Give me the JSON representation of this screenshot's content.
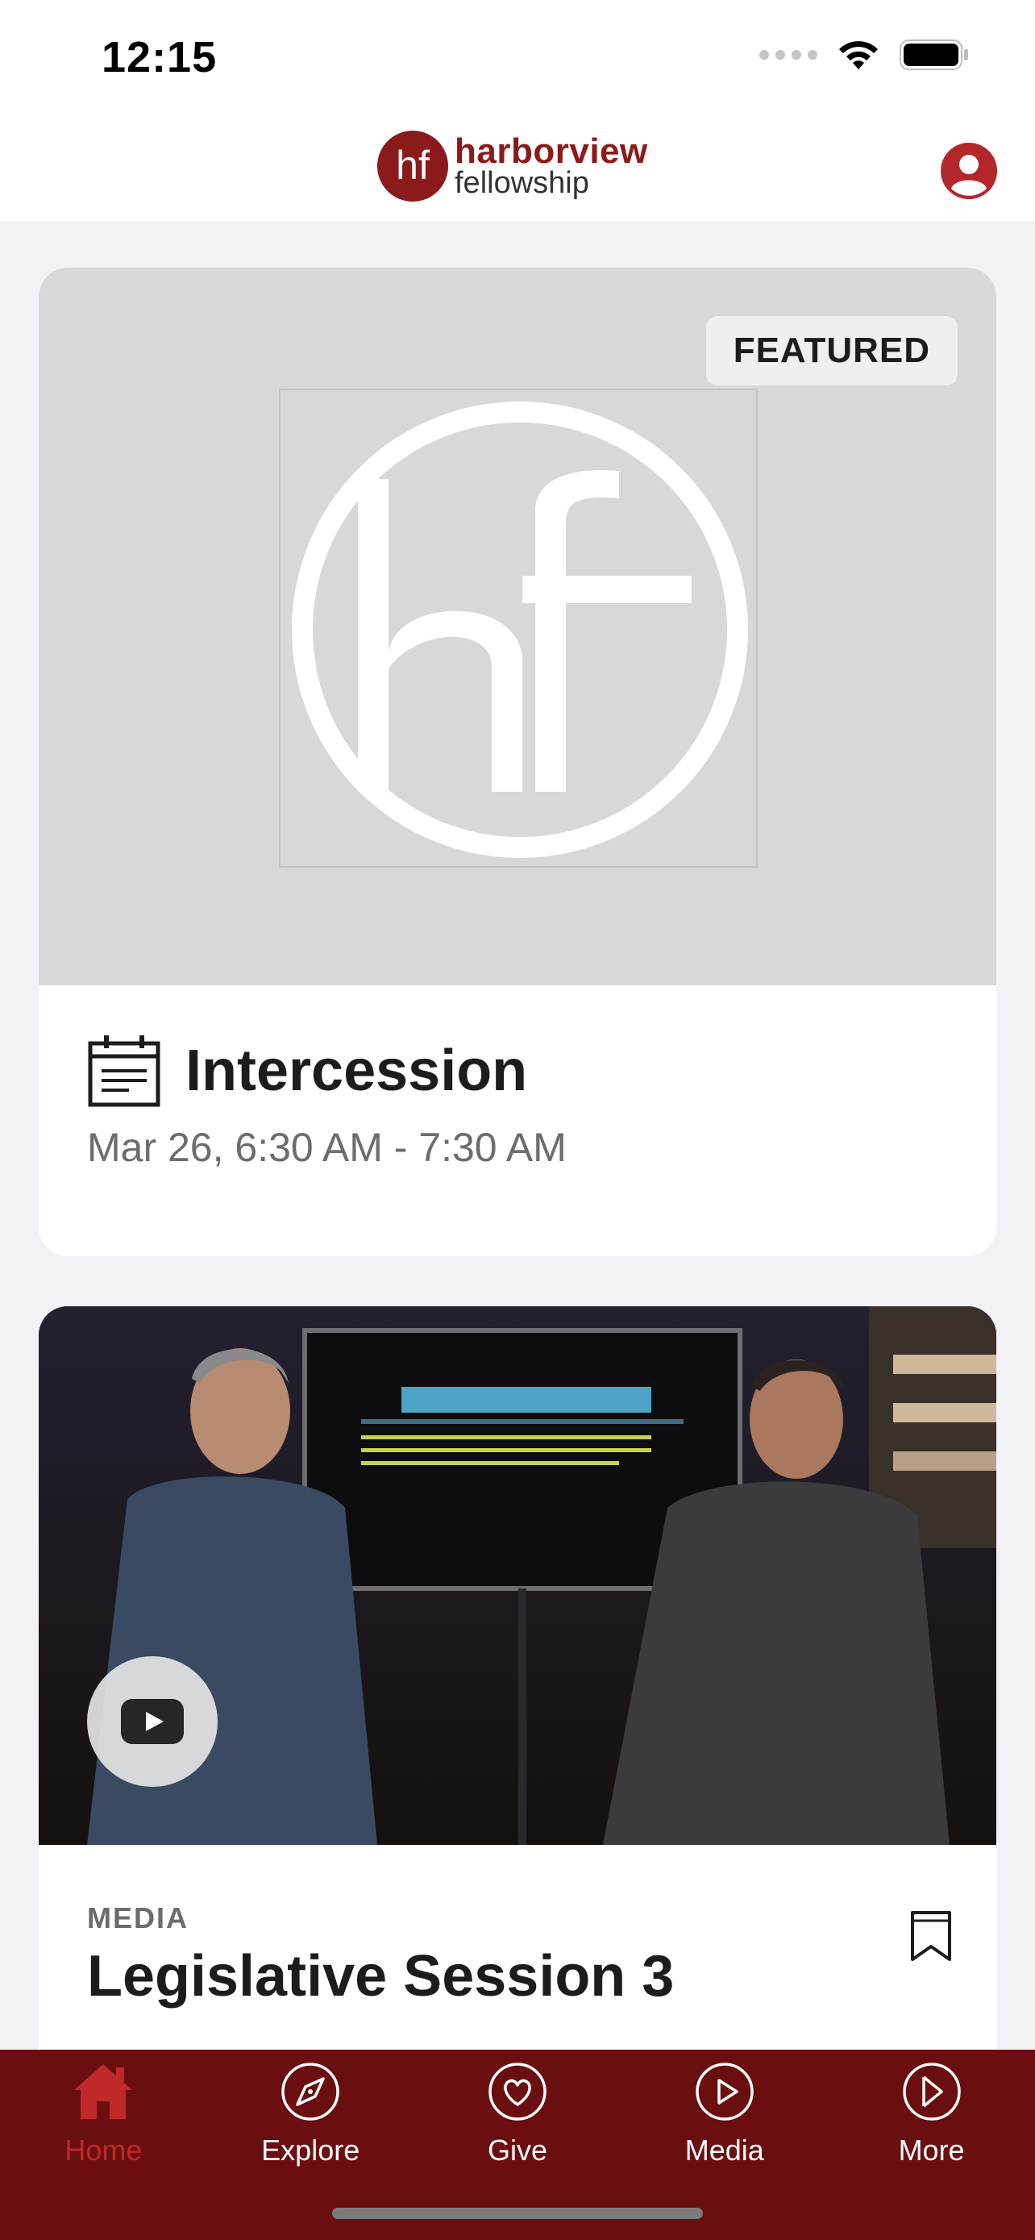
{
  "status_bar": {
    "time": "12:15"
  },
  "header": {
    "logo_mark": "hf",
    "logo_line1": "harborview",
    "logo_line2": "fellowship",
    "profile_icon": "person-icon"
  },
  "featured_card": {
    "badge": "FEATURED",
    "icon": "calendar-icon",
    "title": "Intercession",
    "time": "Mar 26, 6:30 AM - 7:30 AM"
  },
  "media_card": {
    "kicker": "MEDIA",
    "title": "Legislative Session 3",
    "play_icon": "youtube-play-icon",
    "bookmark_icon": "bookmark-icon"
  },
  "tab_bar": {
    "tabs": [
      {
        "label": "Home",
        "icon": "home-icon",
        "active": true
      },
      {
        "label": "Explore",
        "icon": "compass-icon",
        "active": false
      },
      {
        "label": "Give",
        "icon": "heart-icon",
        "active": false
      },
      {
        "label": "Media",
        "icon": "play-icon",
        "active": false
      },
      {
        "label": "More",
        "icon": "chevron-right-icon",
        "active": false
      }
    ]
  },
  "colors": {
    "brand_red": "#8b1a1a",
    "tab_bar_bg": "#6b0e10",
    "active_tab": "#c0282a",
    "page_bg": "#f2f2f6"
  }
}
